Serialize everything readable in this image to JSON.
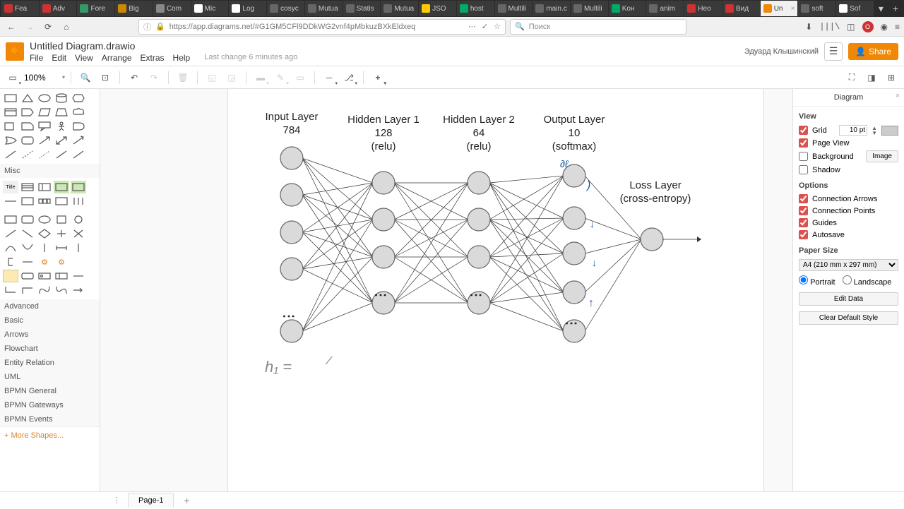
{
  "browser": {
    "tabs": [
      "Fea",
      "Adv",
      "Fore",
      "Big",
      "Com",
      "Mic",
      "Log",
      "cosyc",
      "Mutua",
      "Statis",
      "Mutua",
      "JSO",
      "host",
      "Multili",
      "main.c",
      "Multili",
      "Koн",
      "anim",
      "Heo",
      "Bид",
      "Un",
      "soft",
      "Sof"
    ],
    "active_tab_index": 20,
    "url": "https://app.diagrams.net/#G1GM5CFl9DDkWG2vnf4pMbkuzBXkEldxeq",
    "search_placeholder": "Поиск"
  },
  "app": {
    "title": "Untitled Diagram.drawio",
    "menu": [
      "File",
      "Edit",
      "View",
      "Arrange",
      "Extras",
      "Help"
    ],
    "last_change": "Last change 6 minutes ago",
    "user": "Эдуард Клышинский",
    "share": "Share"
  },
  "toolbar": {
    "zoom": "100%"
  },
  "palettes": {
    "misc": "Misc",
    "advanced": "Advanced",
    "basic": "Basic",
    "arrows": "Arrows",
    "flowchart": "Flowchart",
    "entity": "Entity Relation",
    "uml": "UML",
    "bpmn_general": "BPMN General",
    "bpmn_gateways": "BPMN Gateways",
    "bpmn_events": "BPMN Events",
    "more": "+ More Shapes..."
  },
  "right_panel": {
    "title": "Diagram",
    "view": "View",
    "grid": "Grid",
    "grid_size": "10 pt",
    "page_view": "Page View",
    "background": "Background",
    "image_btn": "Image",
    "shadow": "Shadow",
    "options": "Options",
    "conn_arrows": "Connection Arrows",
    "conn_points": "Connection Points",
    "guides": "Guides",
    "autosave": "Autosave",
    "paper_size_label": "Paper Size",
    "paper_size": "A4 (210 mm x 297 mm)",
    "portrait": "Portrait",
    "landscape": "Landscape",
    "edit_data": "Edit Data",
    "clear_style": "Clear Default Style"
  },
  "diagram": {
    "layers": [
      {
        "title": "Input Layer",
        "size": "784",
        "activation": ""
      },
      {
        "title": "Hidden Layer 1",
        "size": "128",
        "activation": "(relu)"
      },
      {
        "title": "Hidden Layer 2",
        "size": "64",
        "activation": "(relu)"
      },
      {
        "title": "Output Layer",
        "size": "10",
        "activation": "(softmax)"
      }
    ],
    "loss_title": "Loss Layer",
    "loss_sub": "(cross-entropy)",
    "handwritten": "h₁ ="
  },
  "footer": {
    "page1": "Page-1"
  }
}
